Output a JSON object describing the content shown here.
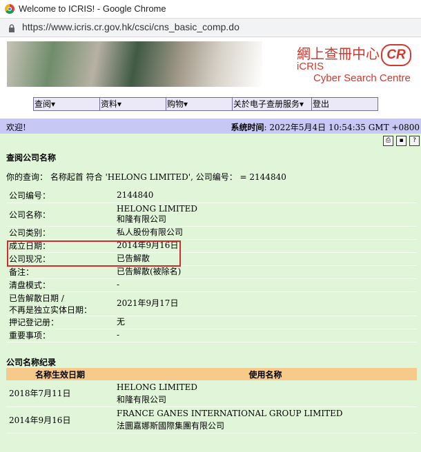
{
  "window": {
    "title": "Welcome to ICRIS! - Google Chrome",
    "url": "https://www.icris.cr.gov.hk/csci/cns_basic_comp.do"
  },
  "banner": {
    "cn": "網上查冊中心",
    "logo": "CR",
    "en1": "iCRIS",
    "en2": "Cyber Search Centre"
  },
  "menu": [
    {
      "label": "查阅▾"
    },
    {
      "label": "资料▾"
    },
    {
      "label": "购物▾"
    },
    {
      "label": "关於电子查册服务▾"
    },
    {
      "label": "登出"
    }
  ],
  "welcome": {
    "text": "欢迎!",
    "time_label": "系统时间",
    "time_value": ": 2022年5月4日 10:54:35 GMT +0800"
  },
  "toolbar_icons": [
    "print-icon",
    "save-icon",
    "help-icon"
  ],
  "section1": {
    "title": "查阅公司名称",
    "query": "你的查询： 名称起首 符合 'HELONG LIMITED', 公司编号： = 2144840"
  },
  "details": [
    {
      "label": "公司编号：",
      "value": "2144840"
    },
    {
      "label": "公司名称：",
      "value": "HELONG LIMITED",
      "value2": "和隆有限公司"
    },
    {
      "label": "公司类别：",
      "value": "私人股份有限公司"
    },
    {
      "label": "成立日期：",
      "value": "2014年9月16日"
    },
    {
      "label": "公司现况：",
      "value": "已告解散"
    },
    {
      "label": "备注：",
      "value": "已告解散(被除名)"
    },
    {
      "label": "清盘模式：",
      "value": "-"
    },
    {
      "label": "已告解散日期 /",
      "label2": "不再是独立实体日期：",
      "value": "2021年9月17日"
    },
    {
      "label": "押记登记册：",
      "value": "无"
    },
    {
      "label": "重要事项：",
      "value": "-"
    }
  ],
  "section2": {
    "title": "公司名称纪录",
    "col1": "名称生效日期",
    "col2": "使用名称",
    "rows": [
      {
        "date": "2018年7月11日",
        "name1": "HELONG LIMITED",
        "name2": "和隆有限公司"
      },
      {
        "date": "2014年9月16日",
        "name1": "FRANCE GANES INTERNATIONAL GROUP LIMITED",
        "name2": "法圜嘉娜斯國際集團有限公司"
      }
    ]
  },
  "colors": {
    "content_bg": "#e1f6d9",
    "welcome_bg": "#c8c8f4",
    "header_bg": "#f7c98a",
    "highlight": "#d22b2b",
    "brand": "#d2372c"
  }
}
